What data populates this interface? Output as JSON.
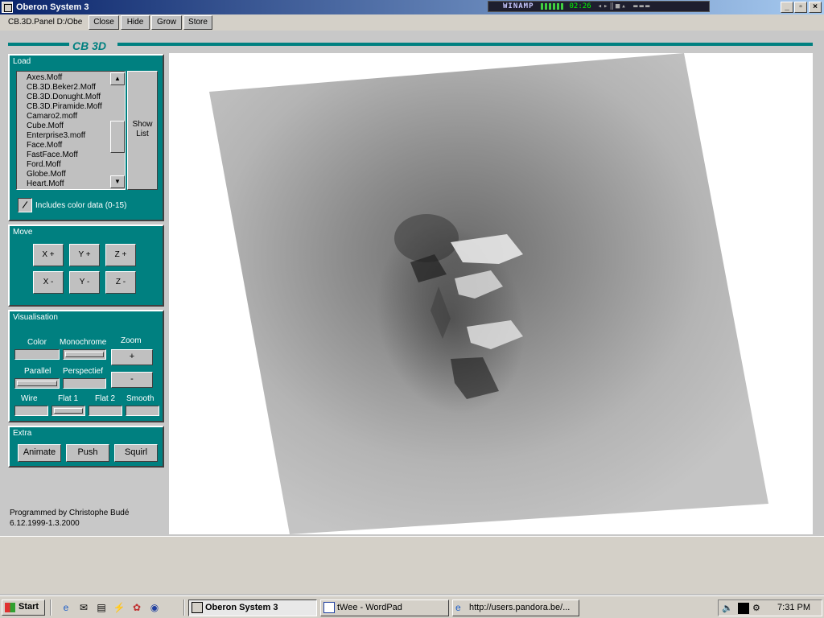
{
  "window": {
    "title": "Oberon System 3"
  },
  "winamp": {
    "label": "WINAMP",
    "time": "02:26"
  },
  "toolbar": {
    "path": "CB.3D.Panel D:/Obe",
    "close": "Close",
    "hide": "Hide",
    "grow": "Grow",
    "store": "Store"
  },
  "panel": {
    "title": "CB 3D",
    "load": {
      "label": "Load",
      "files": [
        "Axes.Moff",
        "CB.3D.Beker2.Moff",
        "CB.3D.Donught.Moff",
        "CB.3D.Piramide.Moff",
        "Camaro2.moff",
        "Cube.Moff",
        "Enterprise3.moff",
        "Face.Moff",
        "FastFace.Moff",
        "Ford.Moff",
        "Globe.Moff",
        "Heart.Moff"
      ],
      "show_list_1": "Show",
      "show_list_2": "List",
      "color_data_label": "Includes color data (0-15)"
    },
    "move": {
      "label": "Move",
      "buttons": [
        "X +",
        "Y +",
        "Z +",
        "X -",
        "Y -",
        "Z -"
      ]
    },
    "visualisation": {
      "label": "Visualisation",
      "color": "Color",
      "monochrome": "Monochrome",
      "zoom": "Zoom",
      "parallel": "Parallel",
      "perspectief": "Perspectief",
      "wire": "Wire",
      "flat1": "Flat 1",
      "flat2": "Flat 2",
      "smooth": "Smooth",
      "zoom_in": "+",
      "zoom_out": "-"
    },
    "extra": {
      "label": "Extra",
      "animate": "Animate",
      "push": "Push",
      "squirl": "Squirl"
    },
    "credit_line1": "Programmed by  Christophe Budé",
    "credit_line2": "6.12.1999-1.3.2000"
  },
  "taskbar": {
    "start": "Start",
    "tasks": [
      "Oberon System 3",
      "tWee - WordPad",
      "http://users.pandora.be/..."
    ],
    "clock": "7:31 PM"
  }
}
